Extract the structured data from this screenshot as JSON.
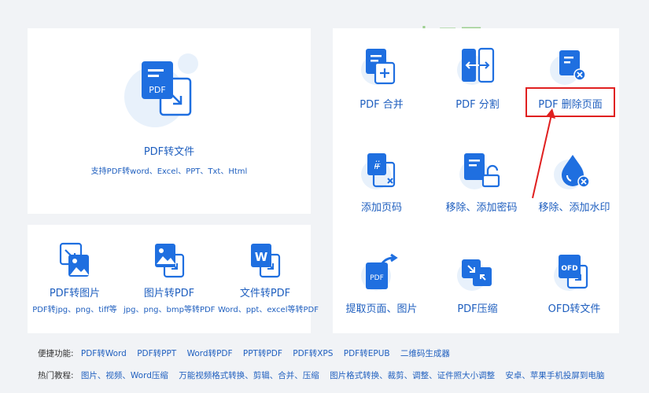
{
  "watermark": "吉云网",
  "main_tool": {
    "label": "PDF转文件",
    "sub": "支持PDF转word、Excel、PPT、Txt、Html",
    "icon_text": "PDF"
  },
  "convert_tools": [
    {
      "label": "PDF转图片",
      "sub": "PDF转jpg、png、tiff等"
    },
    {
      "label": "图片转PDF",
      "sub": "jpg、png、bmp等转PDF"
    },
    {
      "label": "文件转PDF",
      "sub": "Word、ppt、excel等转PDF",
      "icon_text": "W"
    }
  ],
  "tools": [
    {
      "label": "PDF 合并"
    },
    {
      "label": "PDF 分割"
    },
    {
      "label": "PDF 删除页面"
    },
    {
      "label": "添加页码"
    },
    {
      "label": "移除、添加密码"
    },
    {
      "label": "移除、添加水印"
    },
    {
      "label": "提取页面、图片",
      "icon_text": "PDF"
    },
    {
      "label": "PDF压缩"
    },
    {
      "label": "OFD转文件",
      "icon_text": "OFD"
    }
  ],
  "footer": {
    "quick_label": "便捷功能:",
    "quick_links": [
      "PDF转Word",
      "PDF转PPT",
      "Word转PDF",
      "PPT转PDF",
      "PDF转XPS",
      "PDF转EPUB",
      "二维码生成器"
    ],
    "hot_label": "热门教程:",
    "hot_links": [
      "图片、视频、Word压缩",
      "万能视频格式转换、剪辑、合并、压缩",
      "图片格式转换、裁剪、调整、证件照大小调整",
      "安卓、苹果手机投屏到电脑"
    ]
  },
  "colors": {
    "accent": "#1f6fe0",
    "highlight": "#e02020",
    "watermark": "#9ccf8f"
  }
}
